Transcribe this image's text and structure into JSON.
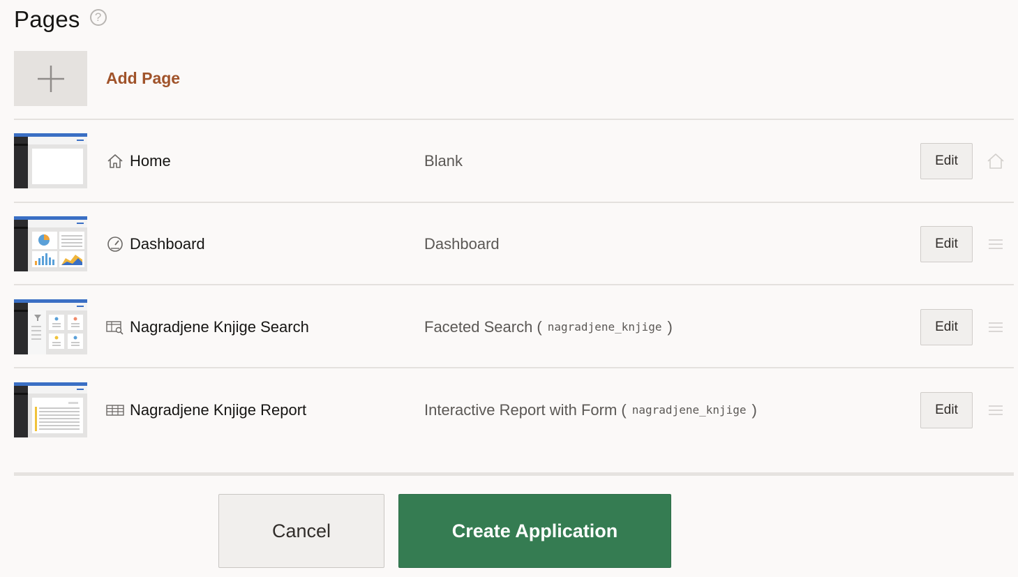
{
  "header": {
    "title": "Pages",
    "help_icon": "question-circle-icon"
  },
  "add_page": {
    "label": "Add Page",
    "icon": "plus-icon"
  },
  "pages": [
    {
      "name": "Home",
      "type": "Blank",
      "source": "",
      "icon": "home-icon",
      "edit_label": "Edit",
      "end_icon": "home-outline-icon"
    },
    {
      "name": "Dashboard",
      "type": "Dashboard",
      "source": "",
      "icon": "gauge-icon",
      "edit_label": "Edit",
      "end_icon": "drag-handle-icon"
    },
    {
      "name": "Nagradjene Knjige Search",
      "type": "Faceted Search",
      "source": "nagradjene_knjige",
      "icon": "faceted-search-icon",
      "edit_label": "Edit",
      "end_icon": "drag-handle-icon"
    },
    {
      "name": "Nagradjene Knjige Report",
      "type": "Interactive Report with Form",
      "source": "nagradjene_knjige",
      "icon": "table-icon",
      "edit_label": "Edit",
      "end_icon": "drag-handle-icon"
    }
  ],
  "footer": {
    "cancel_label": "Cancel",
    "create_label": "Create Application"
  },
  "colors": {
    "accent_link": "#a0532a",
    "primary_button": "#357c52",
    "thumb_bar": "#3a6fc4"
  }
}
